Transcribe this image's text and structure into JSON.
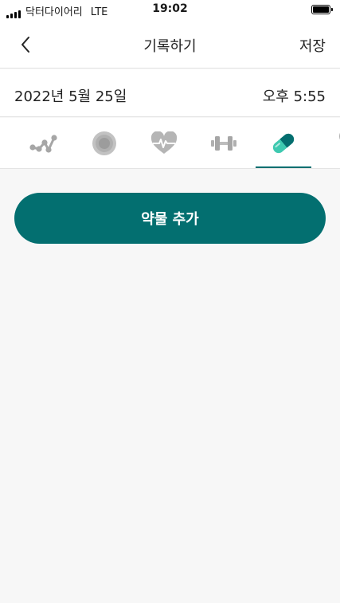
{
  "status_bar": {
    "carrier": "닥터다이어리",
    "network": "LTE",
    "time": "19:02"
  },
  "nav": {
    "title": "기록하기",
    "save_label": "저장"
  },
  "record": {
    "date": "2022년 5월 25일",
    "time": "오후 5:55"
  },
  "tabs": [
    {
      "icon": "blood-sugar-chart-icon",
      "active": false
    },
    {
      "icon": "target-circle-icon",
      "active": false
    },
    {
      "icon": "heart-pulse-icon",
      "active": false
    },
    {
      "icon": "dumbbell-icon",
      "active": false
    },
    {
      "icon": "pill-icon",
      "active": true
    },
    {
      "icon": "food-utensil-icon",
      "active": false
    }
  ],
  "main": {
    "add_medication_label": "약물 추가"
  },
  "colors": {
    "accent": "#036f70",
    "pill_light": "#3ec9b0",
    "pill_dark": "#046e6f",
    "icon_gray": "#a6a6a6",
    "background": "#f7f7f7"
  }
}
